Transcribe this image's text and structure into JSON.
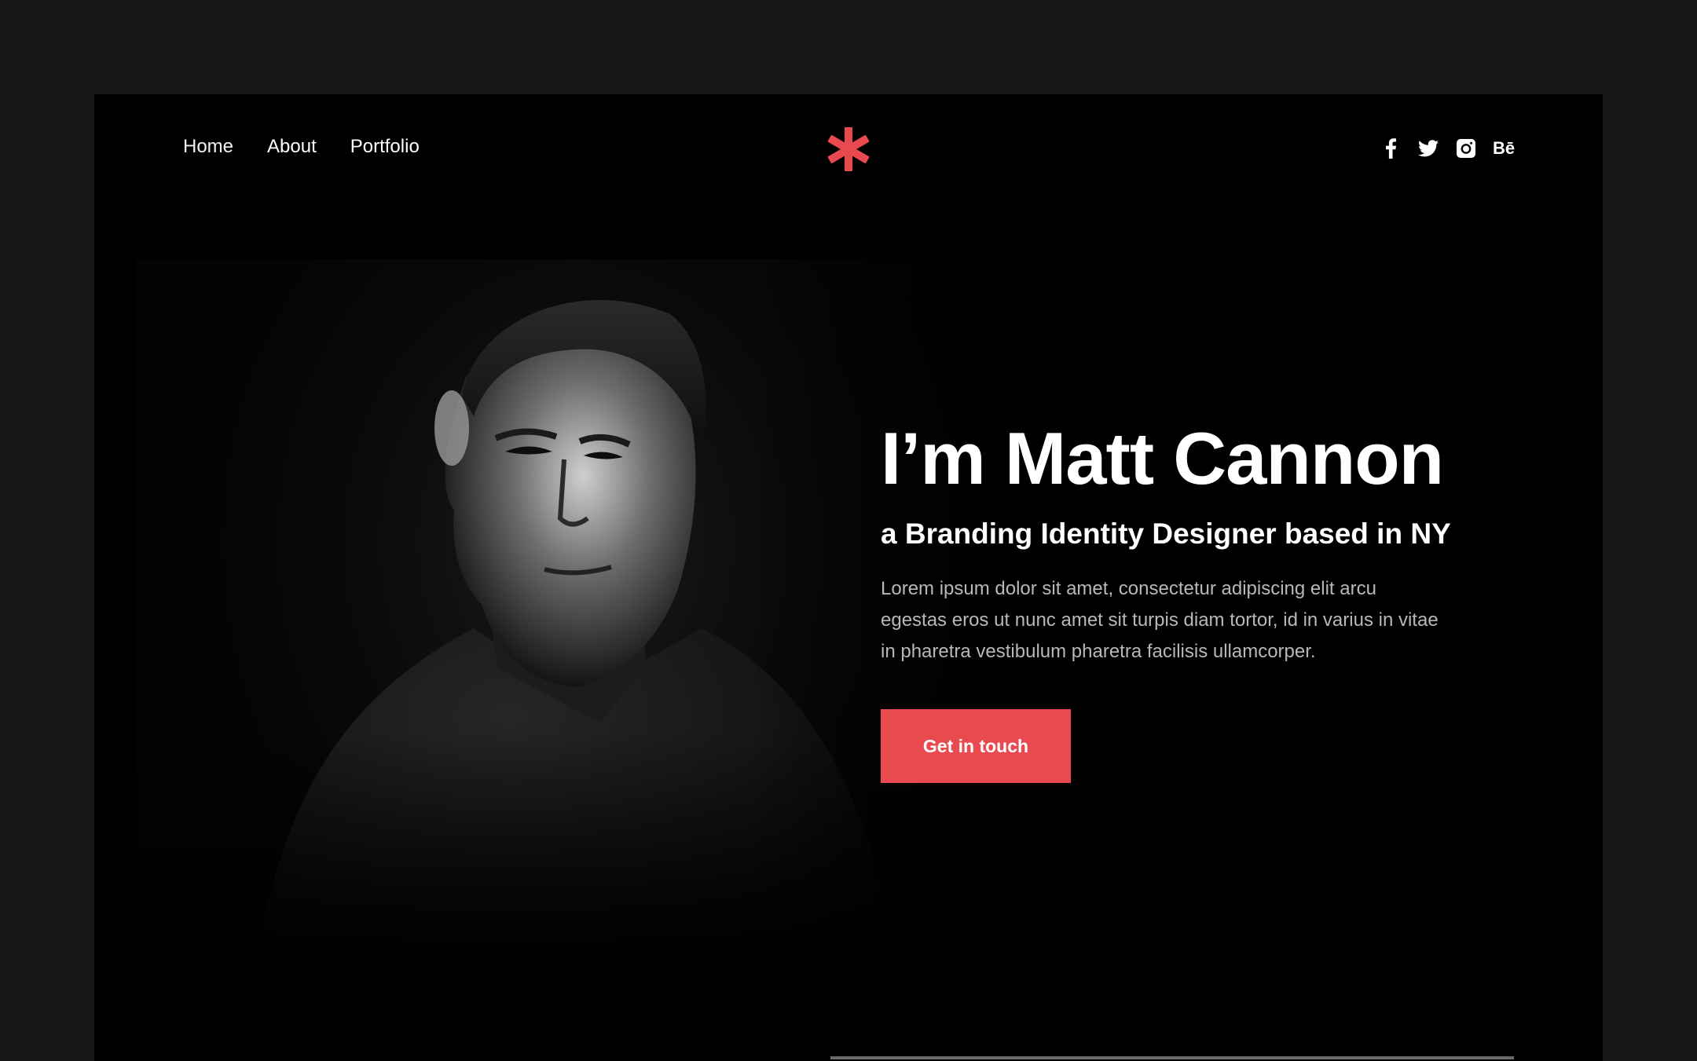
{
  "nav": {
    "items": [
      {
        "label": "Home"
      },
      {
        "label": "About"
      },
      {
        "label": "Portfolio"
      }
    ]
  },
  "logo": {
    "icon": "asterisk-logo",
    "color": "#e84a4f"
  },
  "social": [
    {
      "icon": "facebook-icon"
    },
    {
      "icon": "twitter-icon"
    },
    {
      "icon": "instagram-icon"
    },
    {
      "icon": "behance-icon",
      "label": "Bē"
    }
  ],
  "hero": {
    "title": "I’m Matt Cannon",
    "subtitle": "a Branding Identity Designer based in NY",
    "description": "Lorem ipsum dolor sit amet, consectetur adipiscing elit arcu egestas eros ut nunc amet sit turpis diam tortor, id in varius in vitae in pharetra vestibulum pharetra facilisis ullamcorper.",
    "cta_label": "Get in touch"
  },
  "colors": {
    "accent": "#e84a4f",
    "background": "#000000",
    "outer": "#161616"
  }
}
